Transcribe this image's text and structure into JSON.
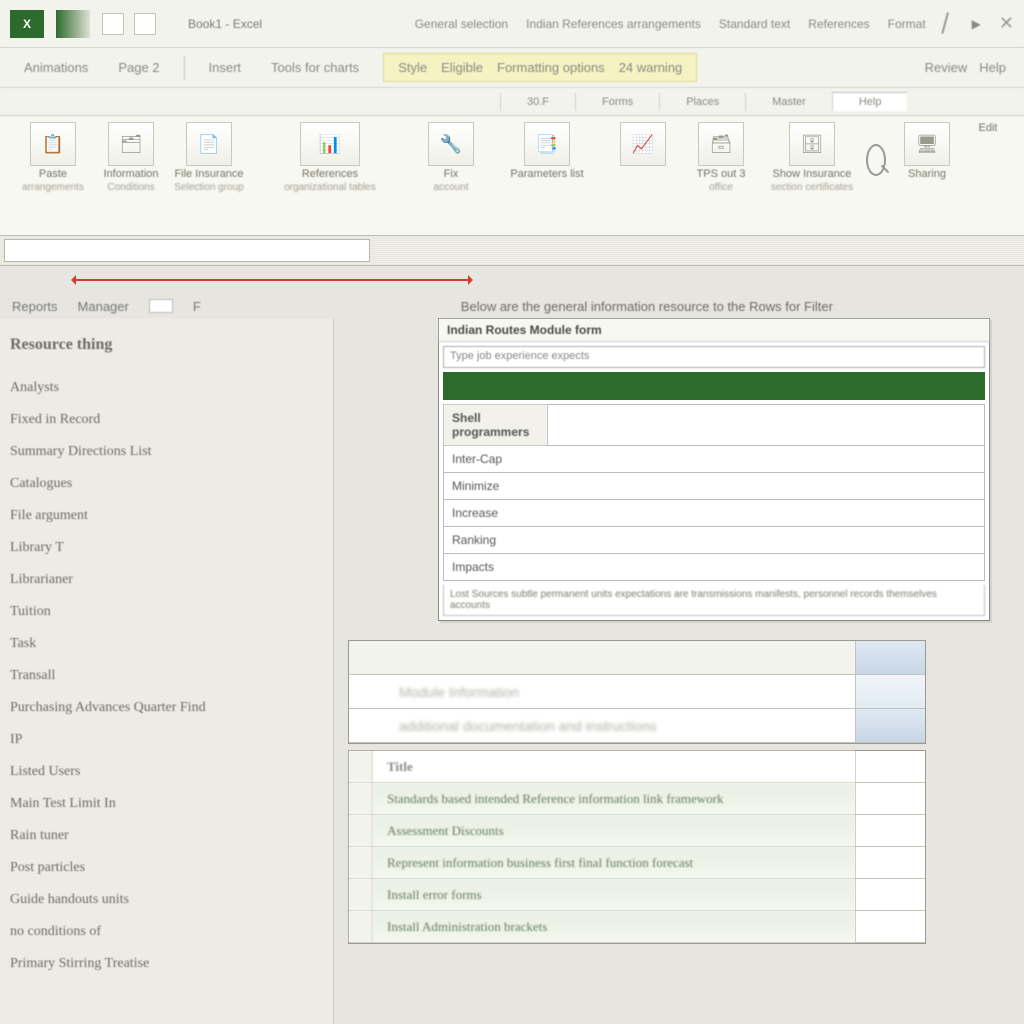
{
  "titlebar": {
    "app_glyph": "X",
    "doc_title": "Book1 - Excel",
    "menu_items": [
      "General selection",
      "Indian References arrangements",
      "Standard text",
      "References",
      "Format"
    ],
    "pointer_glyph": "▶"
  },
  "ribbon_tabs": {
    "left": [
      "Animations",
      "Page 2",
      "Insert"
    ],
    "mid": "Tools for charts",
    "highlight": [
      "Style",
      "Eligible",
      "Formatting options",
      "24 warning"
    ],
    "right": [
      "Review",
      "Help"
    ]
  },
  "sub_tabs": [
    "30.F",
    "Forms",
    "Places",
    "Master",
    "Help"
  ],
  "ribbon_items": [
    {
      "label": "Paste",
      "sub": "arrangements"
    },
    {
      "label": "Information",
      "sub": "Conditions"
    },
    {
      "label": "File Insurance",
      "sub": "Selection group"
    },
    {
      "label": "References",
      "sub": "organizational tables"
    },
    {
      "label": "Fix",
      "sub": "account"
    },
    {
      "label": "Parameters list",
      "sub": ""
    },
    {
      "label": "",
      "sub": ""
    },
    {
      "label": "TPS out 3",
      "sub": "office"
    },
    {
      "label": "Show Insurance",
      "sub": "section certificates"
    },
    {
      "label": "Sharing",
      "sub": ""
    },
    {
      "label": "Edit",
      "sub": ""
    }
  ],
  "crumb": {
    "a": "Reports",
    "b": "Manager",
    "c": "F",
    "desc": "Below are the general information resource to the Rows for Filter"
  },
  "sidebar": {
    "heading": "Resource thing",
    "items": [
      "Analysts",
      "Fixed in Record",
      "Summary Directions List",
      "Catalogues",
      "File argument",
      "Library T",
      "Librarianer",
      "Tuition",
      "Task",
      "Transall",
      "Purchasing Advances Quarter Find",
      "IP",
      "Listed Users",
      "Main Test Limit In",
      "Rain tuner",
      "Post particles",
      "Guide handouts units",
      "no conditions of",
      "Primary Stirring Treatise"
    ]
  },
  "dialog": {
    "title": "Indian Routes Module form",
    "search_placeholder": "Type job experience expects",
    "header_cell": "Shell programmers",
    "rows": [
      "Inter-Cap",
      "Minimize",
      "Increase",
      "Ranking",
      "Impacts"
    ],
    "footer": "Lost Sources subtle permanent units expectations are transmissions manifests, personnel records themselves accounts"
  },
  "lower1": {
    "rows": [
      "",
      "Module Information",
      "additional documentation and instructions"
    ]
  },
  "lower2": {
    "rows": [
      "Title",
      "Standards based intended Reference information link framework",
      "Assessment Discounts",
      "Represent information business first final function forecast",
      "Install error forms",
      "Install Administration brackets"
    ]
  }
}
